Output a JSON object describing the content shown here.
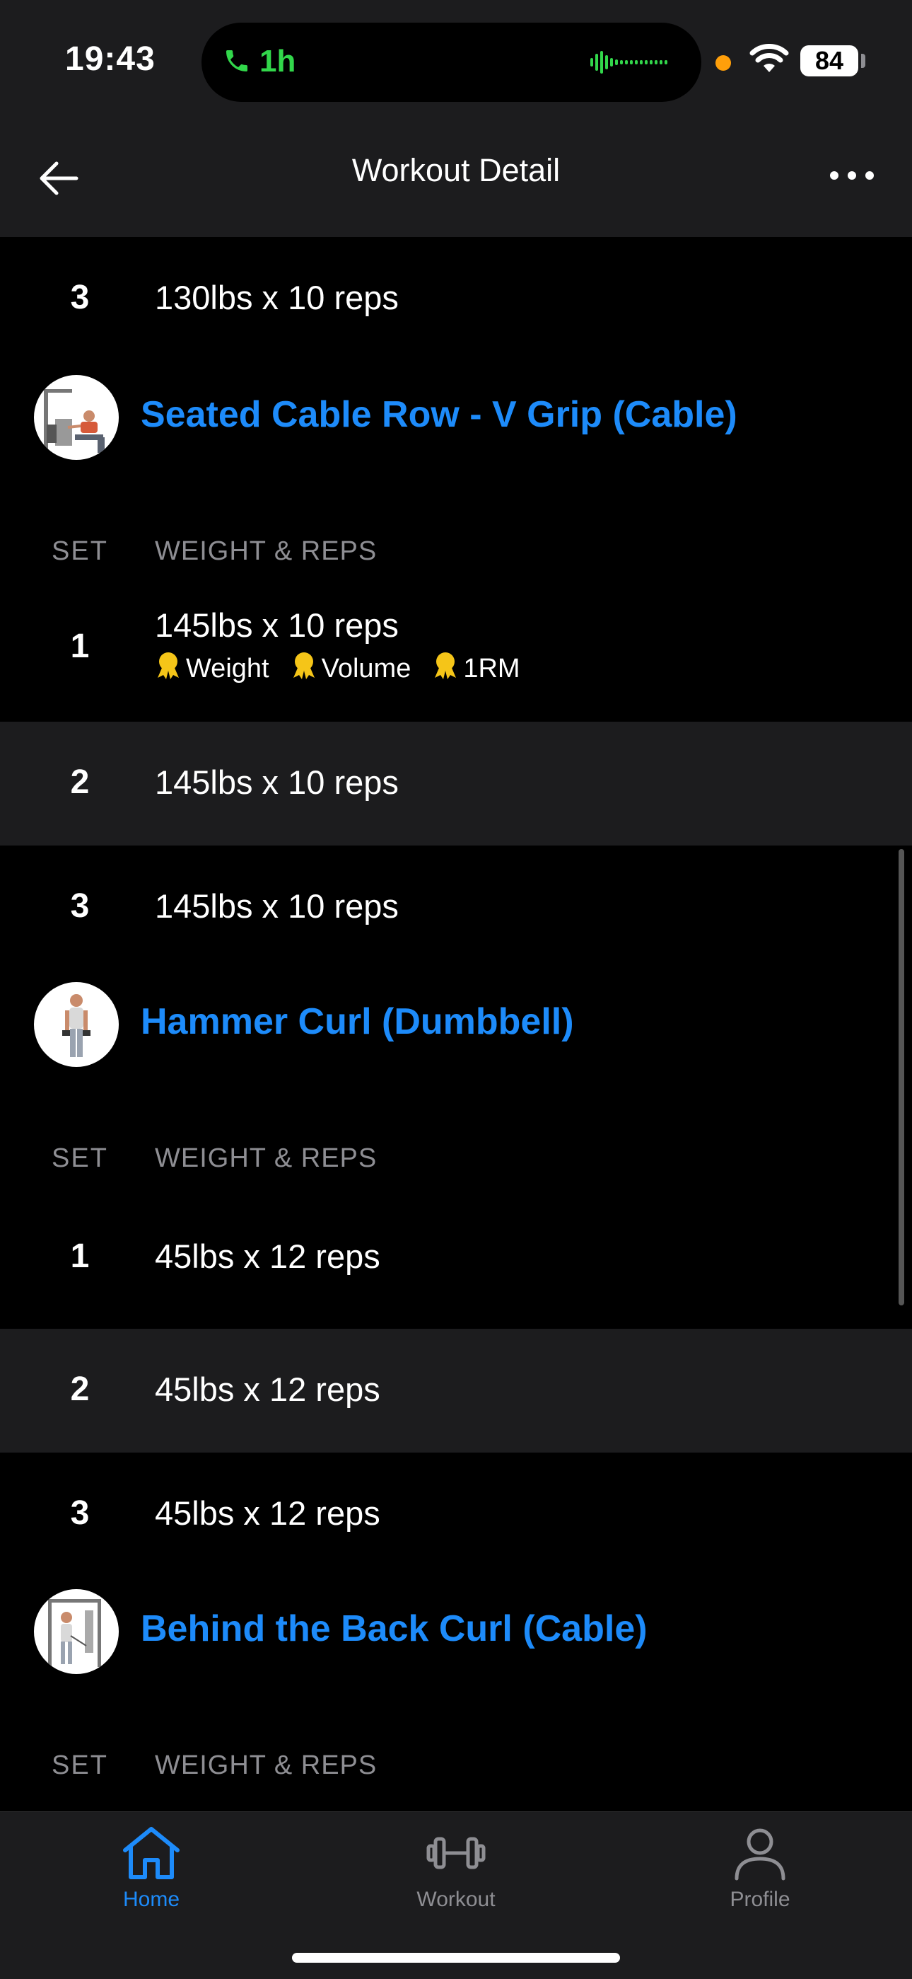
{
  "status_bar": {
    "time": "19:43",
    "call_duration": "1h",
    "battery": "84"
  },
  "nav": {
    "title": "Workout Detail"
  },
  "columns": {
    "set": "SET",
    "weight_reps": "WEIGHT & REPS"
  },
  "top_set": {
    "num": "3",
    "text": "130lbs x 10 reps"
  },
  "exercises": [
    {
      "name": "Seated Cable Row - V Grip (Cable)",
      "sets": [
        {
          "num": "1",
          "text": "145lbs x 10 reps",
          "records": [
            "Weight",
            "Volume",
            "1RM"
          ]
        },
        {
          "num": "2",
          "text": "145lbs x 10 reps"
        },
        {
          "num": "3",
          "text": "145lbs x 10 reps"
        }
      ]
    },
    {
      "name": "Hammer Curl (Dumbbell)",
      "sets": [
        {
          "num": "1",
          "text": "45lbs x 12 reps"
        },
        {
          "num": "2",
          "text": "45lbs x 12 reps"
        },
        {
          "num": "3",
          "text": "45lbs x 12 reps"
        }
      ]
    },
    {
      "name": "Behind the Back Curl (Cable)",
      "sets": []
    }
  ],
  "tabs": [
    {
      "label": "Home",
      "icon": "home-icon",
      "active": true
    },
    {
      "label": "Workout",
      "icon": "dumbbell-icon",
      "active": false
    },
    {
      "label": "Profile",
      "icon": "profile-icon",
      "active": false
    }
  ],
  "colors": {
    "accent": "#1d8bfa",
    "call_green": "#32d74b",
    "medal": "#f5c518",
    "muted": "#8e8e93"
  }
}
